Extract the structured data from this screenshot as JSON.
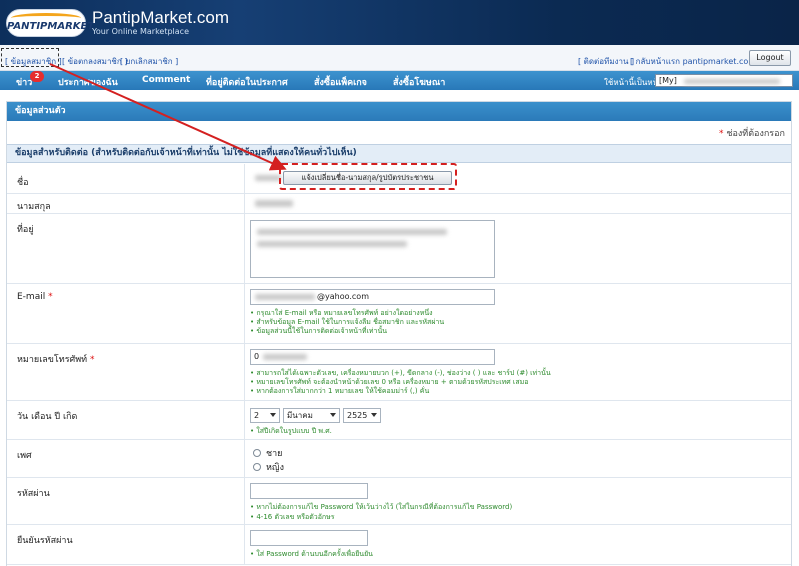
{
  "header": {
    "logo_text": "PANTIPMARKET",
    "brand": "PantipMarket.com",
    "tagline": "Your Online Marketplace"
  },
  "topbar": {
    "member_info": "[ ข้อมูลสมาชิก ]",
    "member_contract": "[ ข้อตกลงสมาชิก ]",
    "cancel_member": "[ ยกเลิกสมาชิก ]",
    "contact_staff": "[ ติดต่อทีมงาน ]",
    "back_home": "[ กลับหน้าแรก pantipmarket.com ]",
    "logout": "Logout"
  },
  "nav": {
    "items": [
      "ข่าว",
      "ประกาศของฉัน",
      "Comment",
      "ที่อยู่ติดต่อในประกาศ",
      "สั่งซื้อแพ็คเกจ",
      "สั่งซื้อโฆษณา"
    ],
    "news_badge": "2",
    "homepage_label": "ใช้หน้านี้เป็นหน้าหลัก :",
    "homepage_value": "[My]",
    "colors": {
      "nav_bg": "#2e80c0",
      "badge": "#e62e2e"
    }
  },
  "form": {
    "section_title": "ข้อมูลส่วนตัว",
    "required_note": "ช่องที่ต้องกรอก",
    "required_mark": "*",
    "subsection_title": "ข้อมูลสำหรับติดต่อ (สำหรับติดต่อกับเจ้าหน้าที่เท่านั้น ไม่ใช่ข้อมูลที่แสดงให้คนทั่วไปเห็น)",
    "name_label": "ชื่อ",
    "change_name_button": "แจ้งเปลี่ยนชื่อ-นามสกุล/รูปบัตรประชาชน",
    "surname_label": "นามสกุล",
    "address_label": "ที่อยู่",
    "email_label": "E-mail",
    "email_value": "@yahoo.com",
    "email_hints": [
      "• กรุณาใส่ E-mail หรือ หมายเลขโทรศัพท์ อย่างใดอย่างหนึ่ง",
      "• สำหรับข้อมูล E-mail ใช้ในการแจ้งลืม ชื่อสมาชิก และรหัสผ่าน",
      "• ข้อมูลส่วนนี้ใช้ในการติดต่อเจ้าหน้าที่เท่านั้น"
    ],
    "phone_label": "หมายเลขโทรศัพท์",
    "phone_value": "0",
    "phone_hints": [
      "• สามารถใส่ได้เฉพาะตัวเลข, เครื่องหมายบวก (+), ขีดกลาง (-), ช่องว่าง ( ) และ ชาร์ป (#) เท่านั้น",
      "• หมายเลขโทรศัพท์ จะต้องนำหน้าด้วยเลข 0 หรือ เครื่องหมาย + ตามด้วยรหัสประเทศ เสมอ",
      "• หากต้องการใส่มากกว่า 1 หมายเลข ให้ใช้คอมม่าร์ (,) คั่น"
    ],
    "birth_label": "วัน เดือน ปี เกิด",
    "birth_day": "2",
    "birth_month": "มีนาคม",
    "birth_year": "2525",
    "birth_hint": "• ใส่ปีเกิดในรูปแบบ ปี พ.ศ.",
    "gender_label": "เพศ",
    "gender_options": [
      "ชาย",
      "หญิง"
    ],
    "password_label": "รหัสผ่าน",
    "password_hints": [
      "• หากไม่ต้องการแก้ไข Password ให้เว้นว่างไว้ (ใส่ในกรณีที่ต้องการแก้ไข Password)",
      "• 4-16 ตัวเลข หรือตัวอักษร"
    ],
    "confirm_label": "ยืนยันรหัสผ่าน",
    "confirm_hint": "• ใส่ Password ด้านบนอีกครั้งเพื่อยืนยัน"
  }
}
